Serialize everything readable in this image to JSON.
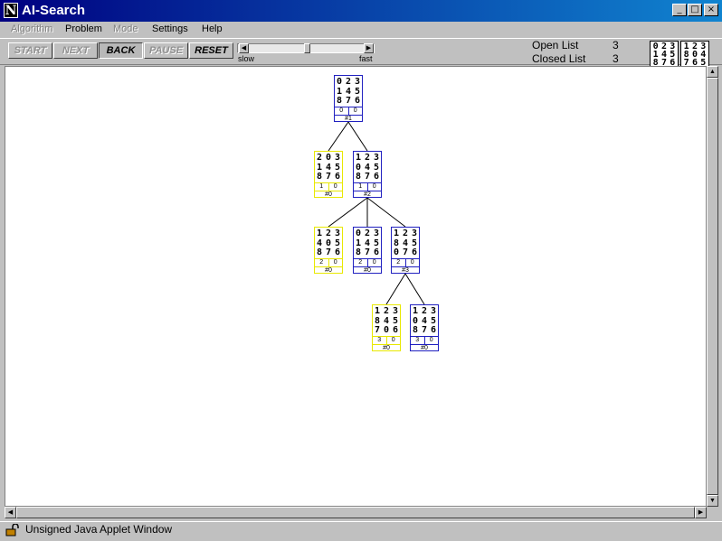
{
  "window": {
    "title": "AI-Search",
    "logo_letter": "N",
    "minimize": "_",
    "maximize": "□",
    "close": "×"
  },
  "menu": [
    {
      "label": "Algorithm",
      "enabled": false
    },
    {
      "label": "Problem",
      "enabled": true
    },
    {
      "label": "Mode",
      "enabled": false
    },
    {
      "label": "Settings",
      "enabled": true
    },
    {
      "label": "Help",
      "enabled": true
    }
  ],
  "toolbar": {
    "buttons": [
      {
        "label": "START",
        "enabled": false
      },
      {
        "label": "NEXT",
        "enabled": false
      },
      {
        "label": "BACK",
        "enabled": true,
        "pressed": true
      },
      {
        "label": "PAUSE",
        "enabled": false
      },
      {
        "label": "RESET",
        "enabled": true
      }
    ],
    "speed": {
      "label_min": "slow",
      "label_max": "fast",
      "value_fraction": 0.5
    },
    "open_list": {
      "label": "Open List",
      "count": "3"
    },
    "closed_list": {
      "label": "Closed List",
      "count": "3"
    },
    "start_state": [
      "0",
      "2",
      "3",
      "1",
      "4",
      "5",
      "8",
      "7",
      "6"
    ],
    "goal_state": [
      "1",
      "2",
      "3",
      "8",
      "0",
      "4",
      "7",
      "6",
      "5"
    ]
  },
  "tree": {
    "nodes": [
      {
        "id": "n1",
        "board": [
          "0",
          "2",
          "3",
          "1",
          "4",
          "5",
          "8",
          "7",
          "6"
        ],
        "g": "0",
        "h": "0",
        "label": "#1",
        "status": "closed"
      },
      {
        "id": "n2",
        "board": [
          "2",
          "0",
          "3",
          "1",
          "4",
          "5",
          "8",
          "7",
          "6"
        ],
        "g": "1",
        "h": "0",
        "label": "#0",
        "status": "open"
      },
      {
        "id": "n3",
        "board": [
          "1",
          "2",
          "3",
          "0",
          "4",
          "5",
          "8",
          "7",
          "6"
        ],
        "g": "1",
        "h": "0",
        "label": "#2",
        "status": "closed"
      },
      {
        "id": "n4",
        "board": [
          "1",
          "2",
          "3",
          "4",
          "0",
          "5",
          "8",
          "7",
          "6"
        ],
        "g": "2",
        "h": "0",
        "label": "#0",
        "status": "open"
      },
      {
        "id": "n5",
        "board": [
          "0",
          "2",
          "3",
          "1",
          "4",
          "5",
          "8",
          "7",
          "6"
        ],
        "g": "2",
        "h": "0",
        "label": "#0",
        "status": "closed"
      },
      {
        "id": "n6",
        "board": [
          "1",
          "2",
          "3",
          "8",
          "4",
          "5",
          "0",
          "7",
          "6"
        ],
        "g": "2",
        "h": "0",
        "label": "#3",
        "status": "closed"
      },
      {
        "id": "n7",
        "board": [
          "1",
          "2",
          "3",
          "8",
          "4",
          "5",
          "7",
          "0",
          "6"
        ],
        "g": "3",
        "h": "0",
        "label": "#0",
        "status": "open"
      },
      {
        "id": "n8",
        "board": [
          "1",
          "2",
          "3",
          "0",
          "4",
          "5",
          "8",
          "7",
          "6"
        ],
        "g": "3",
        "h": "0",
        "label": "#0",
        "status": "closed"
      }
    ],
    "edges": [
      [
        "n1",
        "n2"
      ],
      [
        "n1",
        "n3"
      ],
      [
        "n3",
        "n4"
      ],
      [
        "n3",
        "n5"
      ],
      [
        "n3",
        "n6"
      ],
      [
        "n6",
        "n7"
      ],
      [
        "n6",
        "n8"
      ]
    ]
  },
  "status": {
    "text": "Unsigned Java Applet Window"
  },
  "colors": {
    "open_node": "#e8e800",
    "closed_node": "#2020c0",
    "title_bar": "#000080"
  },
  "icons": {
    "scroll_up": "▲",
    "scroll_down": "▼",
    "scroll_left": "◀",
    "scroll_right": "▶",
    "status": "unlocked-padlock-icon"
  }
}
